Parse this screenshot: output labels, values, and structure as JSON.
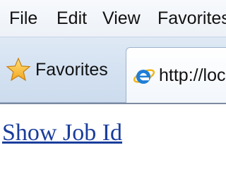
{
  "menubar": {
    "items": [
      {
        "label": "File"
      },
      {
        "label": "Edit"
      },
      {
        "label": "View"
      },
      {
        "label": "Favorites"
      }
    ]
  },
  "favorites_bar": {
    "favorites_label": "Favorites",
    "favorites_icon": "star-icon"
  },
  "tab": {
    "title": "http://loca",
    "icon": "ie-icon"
  },
  "page": {
    "link_text": "Show Job Id",
    "link_color": "#1a3d9c"
  }
}
